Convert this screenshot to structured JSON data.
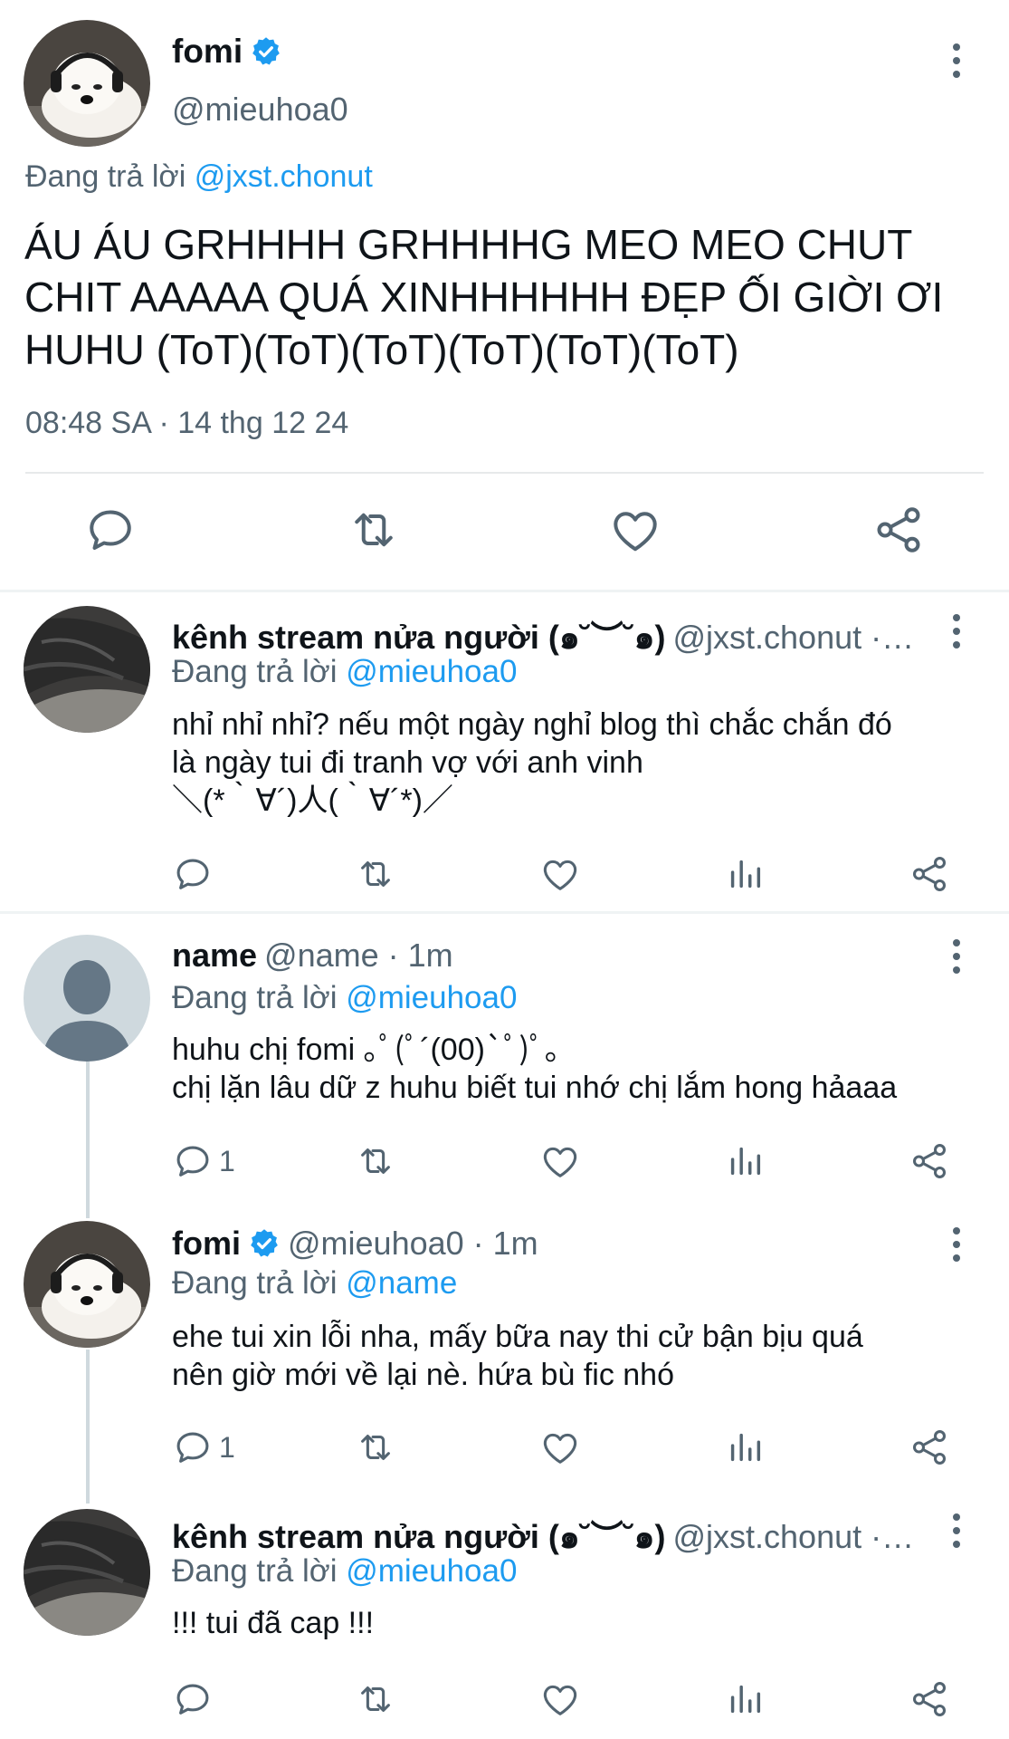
{
  "main_tweet": {
    "display_name": "fomi",
    "handle": "@mieuhoa0",
    "reply_prefix": "Đang trả lời",
    "reply_to": "@jxst.chonut",
    "text": "ÁU ÁU GRHHHH GRHHHHG MEO MEO CHUT CHIT AAAAA QUÁ XINHHHHHH ĐẸP ỐI GIỜI ƠI HUHU (ToT)(ToT)(ToT)(ToT)(ToT)(ToT)",
    "timestamp": "08:48 SA · 14 thg 12 24",
    "icons": [
      "reply-icon",
      "retweet-icon",
      "like-icon",
      "share-icon"
    ]
  },
  "replies": [
    {
      "display_name": "kênh stream nửa người (๑˘︶˘๑)",
      "handle_time": "@jxst.chonut · …",
      "reply_prefix": "Đang trả lời",
      "reply_to": "@mieuhoa0",
      "text": "nhỉ nhỉ nhỉ? nếu một ngày nghỉ blog thì chắc chắn đó\nlà ngày tui đi tranh vợ với anh vinh\n＼(*｀∀´)人(｀∀´*)／",
      "reply_count": "",
      "verified": false
    },
    {
      "display_name": "name",
      "handle_time": "@name · 1m",
      "reply_prefix": "Đang trả lời",
      "reply_to": "@mieuhoa0",
      "text": "huhu chị fomi ｡ﾟ(ﾟ´(00)`ﾟ)ﾟ｡\nchị lặn lâu dữ z huhu biết tui nhớ chị lắm hong hảaaa",
      "reply_count": "1",
      "verified": false
    },
    {
      "display_name": "fomi",
      "handle_time": "@mieuhoa0 · 1m",
      "reply_prefix": "Đang trả lời",
      "reply_to": "@name",
      "text": "ehe tui xin lỗi nha, mấy bữa nay thi cử bận bịu quá\nnên giờ mới về lại nè. hứa bù fic nhó",
      "reply_count": "1",
      "verified": true
    },
    {
      "display_name": "kênh stream nửa người (๑˘︶˘๑)",
      "handle_time": "@jxst.chonut · …",
      "reply_prefix": "Đang trả lời",
      "reply_to": "@mieuhoa0",
      "text": "!!! tui đã cap !!!",
      "reply_count": "",
      "verified": false
    }
  ],
  "colors": {
    "accent": "#1d9bf0",
    "secondary_text": "#536471",
    "primary_text": "#0f1419",
    "divider": "#eff3f4"
  }
}
